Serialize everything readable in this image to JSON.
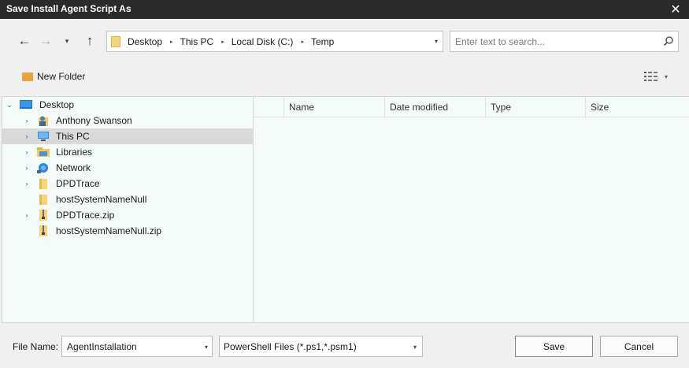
{
  "window": {
    "title": "Save Install Agent Script As",
    "close_glyph": "✕"
  },
  "nav": {
    "back_glyph": "←",
    "forward_glyph": "→",
    "recent_glyph": "▾",
    "up_glyph": "↑",
    "breadcrumbs": [
      "Desktop",
      "This PC",
      "Local Disk (C:)",
      "Temp"
    ],
    "crumb_separator": "▸",
    "dropdown_glyph": "▾"
  },
  "search": {
    "placeholder": "Enter text to search..."
  },
  "toolbar": {
    "new_folder_label": "New Folder",
    "view_arrow": "▾"
  },
  "tree": {
    "items": [
      {
        "label": "Desktop",
        "icon": "desktop-icon",
        "expander": "⌄",
        "expanded": true
      },
      {
        "label": "Anthony Swanson",
        "icon": "user-icon",
        "expander": "›"
      },
      {
        "label": "This PC",
        "icon": "computer-icon",
        "expander": "›",
        "selected": true
      },
      {
        "label": "Libraries",
        "icon": "libraries-icon",
        "expander": "›"
      },
      {
        "label": "Network",
        "icon": "network-icon",
        "expander": "›"
      },
      {
        "label": "DPDTrace",
        "icon": "folder-icon",
        "expander": "›"
      },
      {
        "label": "hostSystemNameNull",
        "icon": "folder-icon",
        "expander": ""
      },
      {
        "label": "DPDTrace.zip",
        "icon": "zip-icon",
        "expander": "›"
      },
      {
        "label": "hostSystemNameNull.zip",
        "icon": "zip-icon",
        "expander": ""
      }
    ]
  },
  "list": {
    "columns": [
      "",
      "Name",
      "Date modified",
      "Type",
      "Size"
    ]
  },
  "bottom": {
    "file_name_label": "File Name:",
    "file_name_value": "AgentInstallation",
    "file_type_value": "PowerShell Files (*.ps1,*.psm1)",
    "dropdown_glyph": "▾",
    "save_label": "Save",
    "cancel_label": "Cancel"
  },
  "colors": {
    "titlebar": "#2b2b2b",
    "dialog_bg": "#f0f0f0",
    "pane_bg": "#f3faf7",
    "selection": "#d9d9d9",
    "expander": "#1a6ccf",
    "folder": "#f7d37b"
  }
}
